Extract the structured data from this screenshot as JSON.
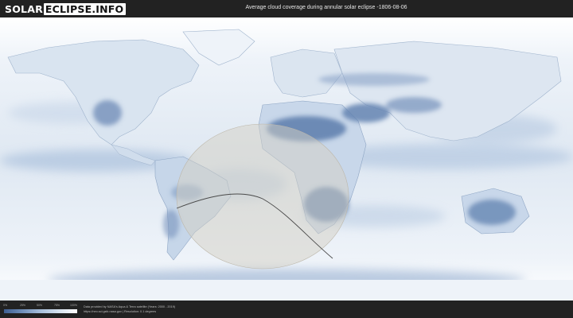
{
  "logo": {
    "part1": "SOLAR",
    "part2": "ECLIPSE.INFO"
  },
  "title": "Average cloud coverage during annular solar eclipse -1806-08-06",
  "legend": {
    "ticks": [
      "0%",
      "25%",
      "50%",
      "75%",
      "100%"
    ],
    "gradient": [
      "#3f5f92",
      "#6f8fba",
      "#a7bfdc",
      "#d6e2ef",
      "#ffffff"
    ]
  },
  "credits": {
    "line1": "Data provided by NASA's Aqua & Terra satellite (Years: 2000 - 2019)",
    "line2": "https://neo.sci.gsfc.nasa.gov | Resolution: 0.1 degrees"
  },
  "map": {
    "colors": {
      "ocean": "#dde7f2",
      "cloudy": "#f4f7fb",
      "clear": "#5c7cab",
      "shadow": "#cfcbc2"
    }
  }
}
